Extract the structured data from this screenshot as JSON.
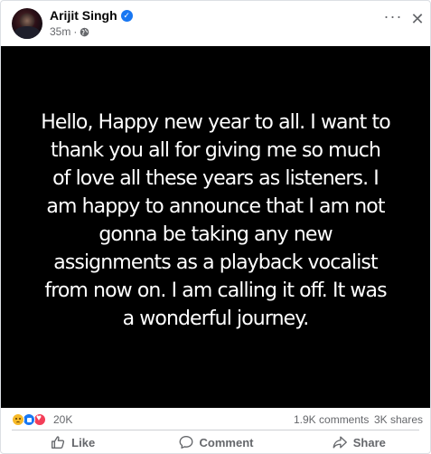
{
  "post": {
    "author": "Arijit Singh",
    "time": "35m",
    "separator": "·",
    "more_icon": "···",
    "close_icon": "✕",
    "image_text": "Hello, Happy new year to all. I want to thank you all for giving me so much of love all these years as listeners. I am happy to announce that I am not gonna be taking any new assignments as a playback vocalist from now on. I am calling it off. It was a wonderful journey."
  },
  "stats": {
    "reactions": "20K",
    "comments": "1.9K comments",
    "shares": "3K shares"
  },
  "actions": {
    "like": "Like",
    "comment": "Comment",
    "share": "Share"
  },
  "colors": {
    "verified": "#1877f2",
    "muted_text": "#65676b",
    "image_bg": "#000000"
  }
}
